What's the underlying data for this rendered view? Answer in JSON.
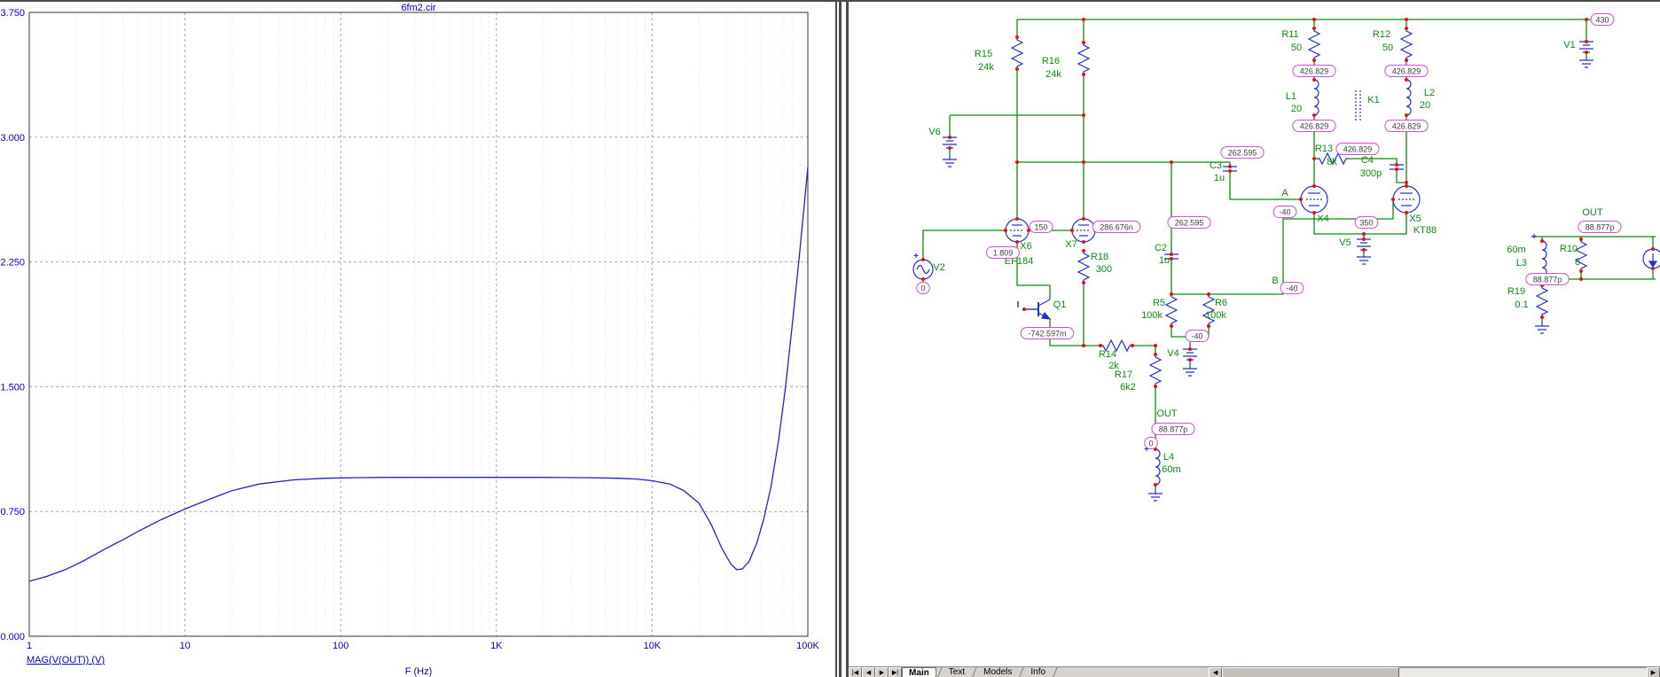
{
  "plot_panel": {
    "title": "6fm2.cir",
    "signal_label": "MAG(V(OUT)) (V)",
    "x_axis_label": "F (Hz)"
  },
  "chart_data": {
    "type": "line",
    "title": "6fm2.cir",
    "xlabel": "F (Hz)",
    "ylabel": "MAG(V(OUT)) (V)",
    "x_scale": "log",
    "xlim": [
      1,
      100000
    ],
    "ylim": [
      0,
      3.75
    ],
    "grid": "dashed",
    "y_ticks": [
      {
        "label": "0.000",
        "value": 0
      },
      {
        "label": "0.750",
        "value": 0.75
      },
      {
        "label": "1.500",
        "value": 1.5
      },
      {
        "label": "2.250",
        "value": 2.25
      },
      {
        "label": "3.000",
        "value": 3.0
      },
      {
        "label": "3.750",
        "value": 3.75
      }
    ],
    "x_ticks": [
      {
        "label": "1",
        "value": 1
      },
      {
        "label": "10",
        "value": 10
      },
      {
        "label": "100",
        "value": 100
      },
      {
        "label": "1K",
        "value": 1000
      },
      {
        "label": "10K",
        "value": 10000
      },
      {
        "label": "100K",
        "value": 100000
      }
    ],
    "series": [
      {
        "name": "MAG(V(OUT))",
        "color": "#2222cc",
        "points": [
          [
            1,
            0.33
          ],
          [
            1.3,
            0.36
          ],
          [
            1.7,
            0.4
          ],
          [
            2.2,
            0.45
          ],
          [
            3,
            0.52
          ],
          [
            4,
            0.58
          ],
          [
            5,
            0.63
          ],
          [
            7,
            0.7
          ],
          [
            10,
            0.765
          ],
          [
            14,
            0.82
          ],
          [
            20,
            0.875
          ],
          [
            30,
            0.915
          ],
          [
            50,
            0.94
          ],
          [
            80,
            0.95
          ],
          [
            120,
            0.953
          ],
          [
            200,
            0.955
          ],
          [
            400,
            0.955
          ],
          [
            1000,
            0.955
          ],
          [
            2000,
            0.955
          ],
          [
            4000,
            0.953
          ],
          [
            6000,
            0.95
          ],
          [
            8000,
            0.945
          ],
          [
            10000,
            0.935
          ],
          [
            13000,
            0.915
          ],
          [
            16000,
            0.875
          ],
          [
            20000,
            0.8
          ],
          [
            24000,
            0.67
          ],
          [
            28000,
            0.53
          ],
          [
            32000,
            0.435
          ],
          [
            35000,
            0.4
          ],
          [
            38000,
            0.405
          ],
          [
            42000,
            0.45
          ],
          [
            47000,
            0.56
          ],
          [
            52000,
            0.7
          ],
          [
            58000,
            0.9
          ],
          [
            65000,
            1.18
          ],
          [
            72000,
            1.5
          ],
          [
            80000,
            1.9
          ],
          [
            88000,
            2.28
          ],
          [
            95000,
            2.6
          ],
          [
            100000,
            2.82
          ]
        ]
      }
    ]
  },
  "schematic": {
    "colors": {
      "wire": "#0e8c0e",
      "component": "#2430c8",
      "label": "#0e8c0e",
      "badge_border": "#d24fd2",
      "junction_dot": "#e01212"
    },
    "labels": [
      [
        "R15",
        152,
        62
      ],
      [
        "24k",
        155,
        77
      ],
      [
        "R16",
        228,
        70
      ],
      [
        "24k",
        231,
        85
      ],
      [
        "V6",
        97,
        150
      ],
      [
        "R11",
        498,
        40
      ],
      [
        "50",
        505,
        55
      ],
      [
        "R12",
        601,
        40
      ],
      [
        "50",
        608,
        55
      ],
      [
        "V1",
        813,
        52
      ],
      [
        "L1",
        499,
        110
      ],
      [
        "20",
        505,
        124
      ],
      [
        "K1",
        592,
        114
      ],
      [
        "L2",
        655,
        106
      ],
      [
        "20",
        650,
        120
      ],
      [
        "C3",
        414,
        188
      ],
      [
        "1u",
        418,
        202
      ],
      [
        "R13",
        536,
        169
      ],
      [
        "8k",
        545,
        184
      ],
      [
        "C4",
        585,
        182
      ],
      [
        "300p",
        589,
        197
      ],
      [
        "A",
        492,
        219
      ],
      [
        "X4",
        535,
        248
      ],
      [
        "X5",
        639,
        248
      ],
      [
        "KT88",
        650,
        261
      ],
      [
        "V5",
        560,
        275
      ],
      [
        "X6",
        200,
        279
      ],
      [
        "EF184",
        192,
        296
      ],
      [
        "X7",
        251,
        277
      ],
      [
        "R18",
        283,
        291
      ],
      [
        "300",
        288,
        305
      ],
      [
        "C2",
        352,
        281
      ],
      [
        "1u",
        356,
        295
      ],
      [
        "V2",
        102,
        303
      ],
      [
        "Q1",
        238,
        345
      ],
      [
        "B",
        481,
        318
      ],
      [
        "R5",
        350,
        343
      ],
      [
        "100k",
        342,
        357
      ],
      [
        "R6",
        420,
        343
      ],
      [
        "100k",
        414,
        357
      ],
      [
        "R14",
        292,
        401
      ],
      [
        "2k",
        299,
        414
      ],
      [
        "R17",
        310,
        424
      ],
      [
        "6k2",
        315,
        438
      ],
      [
        "V4",
        366,
        400
      ],
      [
        "OUT",
        359,
        468
      ],
      [
        "L4",
        361,
        517
      ],
      [
        "60m",
        364,
        531
      ],
      [
        "OUT",
        839,
        241
      ],
      [
        "60m",
        753,
        283
      ],
      [
        "L3",
        759,
        298
      ],
      [
        "R10",
        812,
        282
      ],
      [
        "8",
        822,
        297
      ],
      [
        "R19",
        753,
        330
      ],
      [
        "0.1",
        759,
        345
      ],
      [
        "+",
        76,
        290,
        "b"
      ],
      [
        "I",
        191,
        345,
        "b"
      ],
      [
        "+",
        336,
        508,
        "b"
      ],
      [
        "+",
        773,
        268,
        "b"
      ]
    ],
    "bubbles": [
      [
        "430",
        850,
        20
      ],
      [
        "426.829",
        525,
        78
      ],
      [
        "426.829",
        525,
        140
      ],
      [
        "426.829",
        629,
        78
      ],
      [
        "426.829",
        629,
        140
      ],
      [
        "426.829",
        574,
        166
      ],
      [
        "262.595",
        444,
        170
      ],
      [
        "262.595",
        384,
        249
      ],
      [
        "150",
        217,
        254
      ],
      [
        "286.676n",
        302,
        254
      ],
      [
        "1.809",
        174,
        283
      ],
      [
        "0",
        84,
        323
      ],
      [
        "-742.597m",
        224,
        374
      ],
      [
        "-40",
        393,
        377
      ],
      [
        "-40",
        500,
        323
      ],
      [
        "-40",
        492,
        237
      ],
      [
        "350",
        584,
        249
      ],
      [
        "88.877p",
        366,
        482
      ],
      [
        "0",
        341,
        498
      ],
      [
        "88.877p",
        847,
        254
      ],
      [
        "88.877p",
        788,
        313
      ]
    ]
  },
  "tab_bar": {
    "nav_icons": [
      {
        "name": "first-page-icon",
        "glyph": "|◀"
      },
      {
        "name": "prev-page-icon",
        "glyph": "◀"
      },
      {
        "name": "next-page-icon",
        "glyph": "▶"
      },
      {
        "name": "last-page-icon",
        "glyph": "▶|"
      }
    ],
    "tabs": [
      {
        "label": "Main",
        "active": true
      },
      {
        "label": "Text",
        "active": false
      },
      {
        "label": "Models",
        "active": false
      },
      {
        "label": "Info",
        "active": false
      }
    ],
    "scrollbar": {
      "left_arrow": "◀",
      "right_arrow": "▶"
    }
  }
}
